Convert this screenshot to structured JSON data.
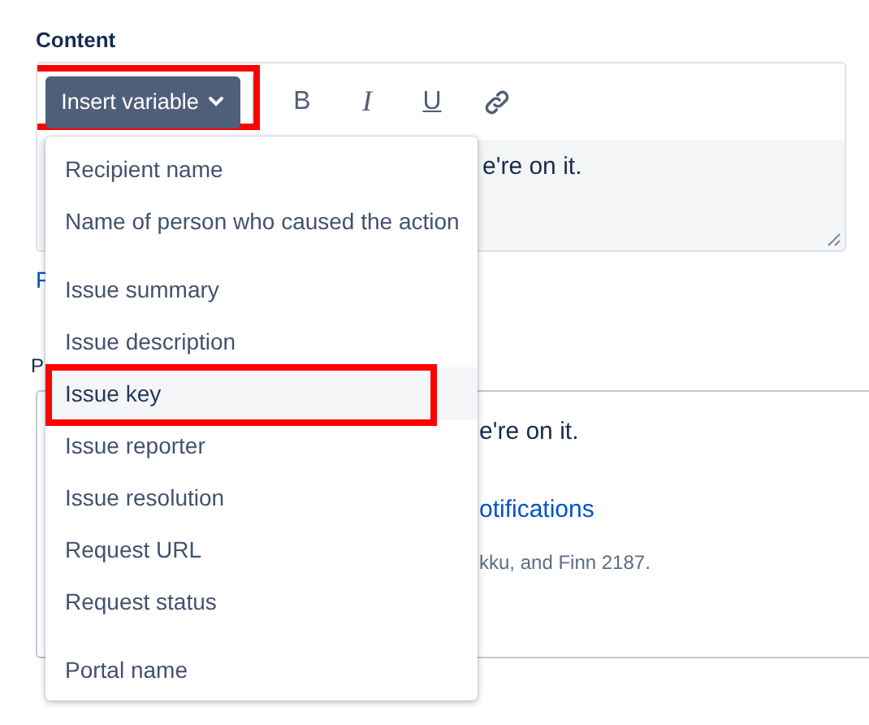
{
  "content_label": "Content",
  "toolbar": {
    "insert_button": {
      "label": "Insert variable",
      "annotated": true
    },
    "format_buttons": [
      {
        "kind": "bold",
        "label": "B"
      },
      {
        "kind": "italic",
        "label": "I"
      },
      {
        "kind": "underline",
        "label": "U"
      },
      {
        "kind": "link"
      }
    ]
  },
  "editor_text": "e're on it.",
  "partial_link": "F",
  "partial_label": "P",
  "preview": {
    "lines": [
      {
        "kind": "text",
        "text": "e're on it."
      },
      {
        "kind": "link",
        "text": "otifications"
      },
      {
        "kind": "small",
        "text": "kku, and Finn 2187."
      }
    ]
  },
  "variable_menu": {
    "groups": [
      [
        {
          "label": "Recipient name",
          "selected": false,
          "annotated": false
        },
        {
          "label": "Name of person who caused the action",
          "selected": false,
          "annotated": false
        }
      ],
      [
        {
          "label": "Issue summary",
          "selected": false,
          "annotated": false
        },
        {
          "label": "Issue description",
          "selected": false,
          "annotated": false
        },
        {
          "label": "Issue key",
          "selected": true,
          "annotated": true
        },
        {
          "label": "Issue reporter",
          "selected": false,
          "annotated": false
        },
        {
          "label": "Issue resolution",
          "selected": false,
          "annotated": false
        },
        {
          "label": "Request URL",
          "selected": false,
          "annotated": false
        },
        {
          "label": "Request status",
          "selected": false,
          "annotated": false
        }
      ],
      [
        {
          "label": "Portal name",
          "selected": false,
          "annotated": false
        }
      ]
    ]
  }
}
